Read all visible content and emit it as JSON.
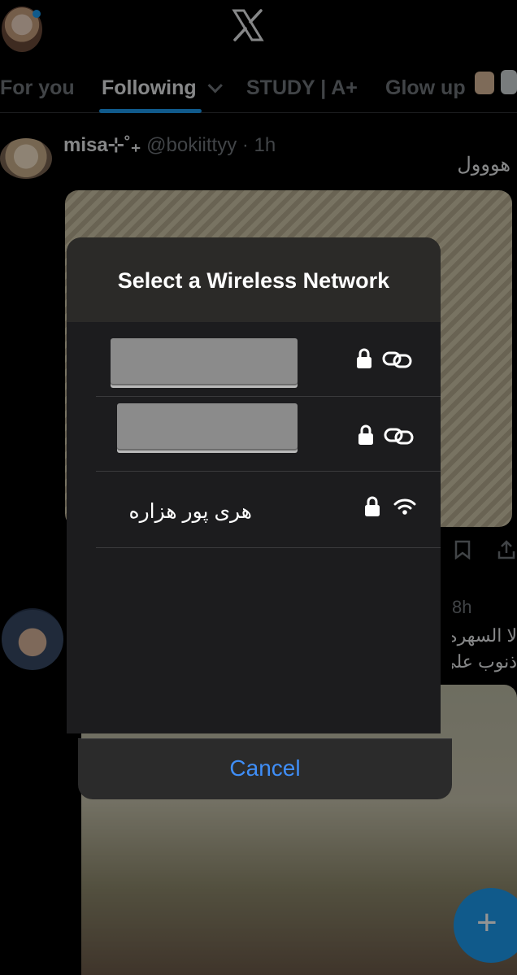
{
  "header": {
    "logo": "x-logo-icon",
    "tabs": [
      {
        "label": "For you"
      },
      {
        "label": "Following"
      },
      {
        "label": "STUDY | A+"
      },
      {
        "label": "Glow up"
      }
    ]
  },
  "feed": {
    "post1": {
      "name": "misa⊹˚₊",
      "handle": "@bokiittyy · 1h",
      "text": "هووول"
    },
    "post2": {
      "time": "8h",
      "text_line1": "لا السهره",
      "text_line2": "ذنوب علي"
    }
  },
  "wifi_sheet": {
    "title": "Select a Wireless Network",
    "networks": [
      {
        "name": "",
        "redacted": true,
        "icons": [
          "lock-icon",
          "link-icon"
        ]
      },
      {
        "name": "",
        "redacted": true,
        "icons": [
          "lock-icon",
          "link-icon"
        ]
      },
      {
        "name": "هری پور هزاره",
        "redacted": false,
        "icons": [
          "lock-icon",
          "wifi-icon"
        ]
      }
    ],
    "cancel_label": "Cancel"
  },
  "colors": {
    "accent": "#1d9bf0",
    "cancel": "#3f8ef7",
    "sheet_bg": "#1c1c1e"
  }
}
